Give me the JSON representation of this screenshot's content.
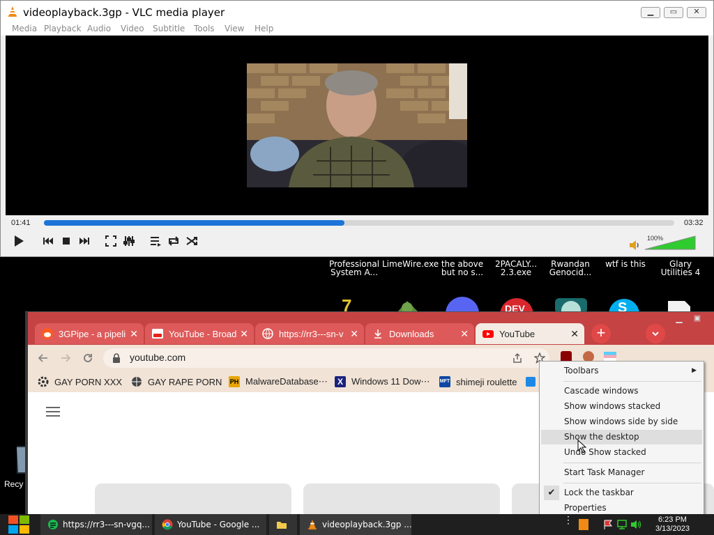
{
  "vlc": {
    "title": "videoplayback.3gp - VLC media player",
    "menu": [
      "Media",
      "Playback",
      "Audio",
      "Video",
      "Subtitle",
      "Tools",
      "View",
      "Help"
    ],
    "elapsed": "01:41",
    "duration": "03:32",
    "progress_fraction": 0.477,
    "volume_label": "100%",
    "volume_fraction": 1.0,
    "accent_color": "#1d74d8",
    "controls": [
      "play-icon",
      "previous-icon",
      "stop-icon",
      "next-icon",
      "fullscreen-icon",
      "extended-settings-icon",
      "playlist-icon",
      "loop-icon",
      "shuffle-icon"
    ]
  },
  "desktop": {
    "icons": [
      {
        "label": "Professional System A...",
        "icon": "archive-icon"
      },
      {
        "label": "LimeWire.exe",
        "icon": "limewire-icon"
      },
      {
        "label": "the above but no s...",
        "icon": "discord-icon"
      },
      {
        "label": "2PACALY... 2.3.exe",
        "icon": "dev-icon"
      },
      {
        "label": "Rwandan Genocid...",
        "icon": "globe-icon"
      },
      {
        "label": "wtf is this",
        "icon": "skype-icon"
      },
      {
        "label": "Glary Utilities 4",
        "icon": "file-icon"
      }
    ],
    "recycle_label": "Recy"
  },
  "chrome": {
    "tabs": [
      {
        "label": "3GPipe - a pipeli",
        "icon": "reddit-icon",
        "active": false
      },
      {
        "label": "YouTube - Broad",
        "icon": "youtube-small-icon",
        "active": false
      },
      {
        "label": "https://rr3---sn-v",
        "icon": "globe-icon",
        "active": false
      },
      {
        "label": "Downloads",
        "icon": "download-icon",
        "active": false
      },
      {
        "label": "YouTube",
        "icon": "youtube-icon",
        "active": true
      }
    ],
    "url": "youtube.com",
    "bookmarks": [
      {
        "label": "GAY PORN XXX",
        "icon": "settings-icon"
      },
      {
        "label": "GAY RAPE PORN",
        "icon": "globe-icon"
      },
      {
        "label": "MalwareDatabase⋯",
        "icon": "ph-icon"
      },
      {
        "label": "Windows 11 Dow⋯",
        "icon": "x-icon"
      },
      {
        "label": "shimeji roulette",
        "icon": "mft-icon"
      }
    ],
    "tab_strip_color": "#c54343"
  },
  "context_menu": {
    "items": [
      {
        "label": "Toolbars",
        "submenu": true
      },
      {
        "label": "Cascade windows"
      },
      {
        "label": "Show windows stacked"
      },
      {
        "label": "Show windows side by side"
      },
      {
        "label": "Show the desktop",
        "highlighted": true
      },
      {
        "label": "Undo Show stacked"
      },
      {
        "label": "Start Task Manager"
      },
      {
        "label": "Lock the taskbar",
        "checked": true
      },
      {
        "label": "Properties"
      }
    ]
  },
  "taskbar": {
    "items": [
      {
        "label": "https://rr3---sn-vgq...",
        "icon": "notepad-icon"
      },
      {
        "label": "YouTube - Google ...",
        "icon": "chrome-icon"
      },
      {
        "label": "",
        "icon": "folder-icon"
      },
      {
        "label": "videoplayback.3gp ...",
        "icon": "vlc-icon"
      }
    ],
    "time": "6:23 PM",
    "date": "3/13/2023"
  }
}
